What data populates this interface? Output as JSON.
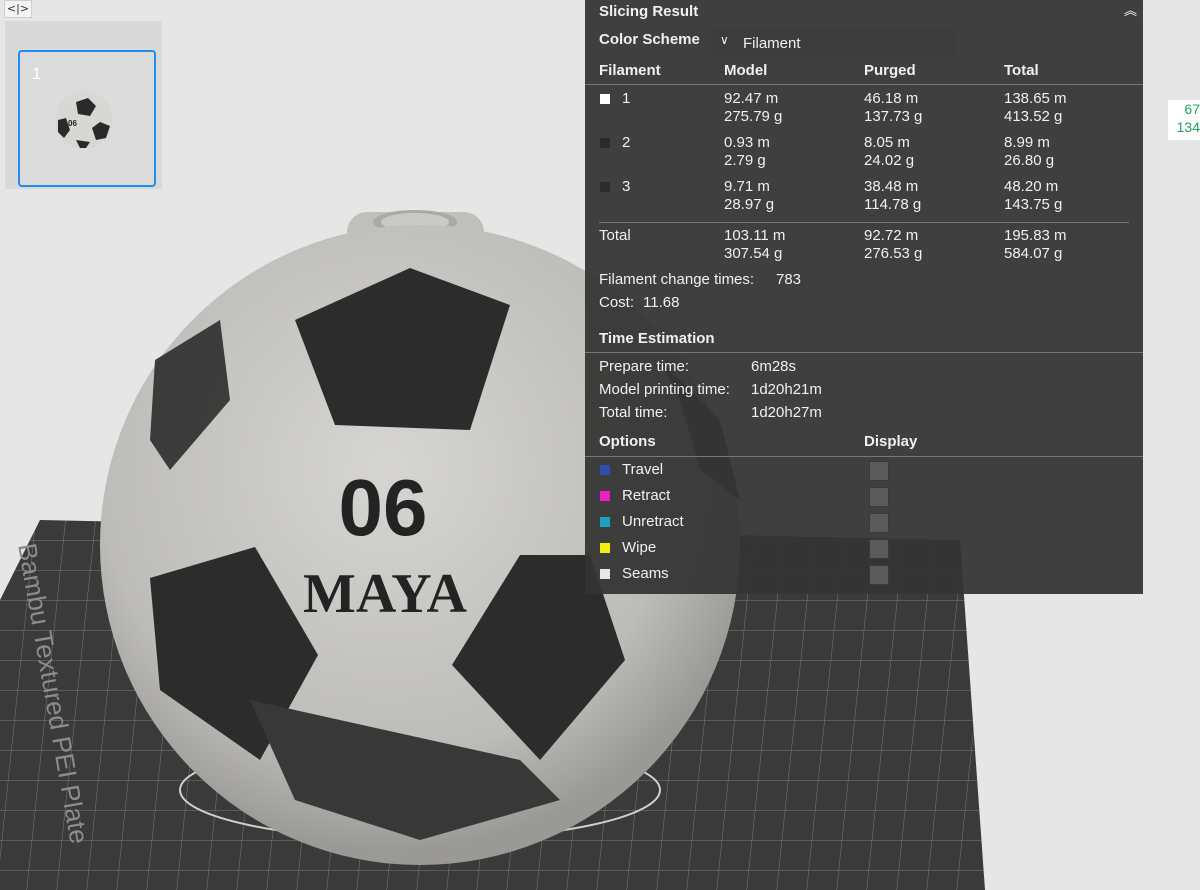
{
  "viewport": {
    "plate_text": "Bambu Textured PEI Plate",
    "model_number": "06",
    "model_name": "MAYA"
  },
  "thumbnail": {
    "toggle_icon": "<|>",
    "plate_number": "1"
  },
  "side_numbers": [
    "67",
    "134"
  ],
  "slicing_result": {
    "title": "Slicing Result",
    "collapse_icon": "double-chevron-up-icon",
    "color_scheme_label": "Color Scheme",
    "color_scheme_value": "Filament",
    "headers": [
      "Filament",
      "Model",
      "Purged",
      "Total"
    ],
    "filaments": [
      {
        "id": "1",
        "color": "#ffffff",
        "model": [
          "92.47 m",
          "275.79 g"
        ],
        "purged": [
          "46.18 m",
          "137.73 g"
        ],
        "total": [
          "138.65 m",
          "413.52 g"
        ]
      },
      {
        "id": "2",
        "color": "#2b2b2b",
        "model": [
          "0.93 m",
          "2.79 g"
        ],
        "purged": [
          "8.05 m",
          "24.02 g"
        ],
        "total": [
          "8.99 m",
          "26.80 g"
        ]
      },
      {
        "id": "3",
        "color": "#2b2b2b",
        "model": [
          "9.71 m",
          "28.97 g"
        ],
        "purged": [
          "38.48 m",
          "114.78 g"
        ],
        "total": [
          "48.20 m",
          "143.75 g"
        ]
      }
    ],
    "totals": {
      "label": "Total",
      "model": [
        "103.11 m",
        "307.54 g"
      ],
      "purged": [
        "92.72 m",
        "276.53 g"
      ],
      "total": [
        "195.83 m",
        "584.07 g"
      ]
    },
    "filament_change": {
      "label": "Filament change times:",
      "value": "783"
    },
    "cost": {
      "label": "Cost:",
      "value": "11.68"
    },
    "time_estimation": {
      "title": "Time Estimation",
      "rows": [
        {
          "label": "Prepare time:",
          "value": "6m28s"
        },
        {
          "label": "Model printing time:",
          "value": "1d20h21m"
        },
        {
          "label": "Total time:",
          "value": "1d20h27m"
        }
      ]
    },
    "options": {
      "title": "Options",
      "display_title": "Display",
      "items": [
        {
          "label": "Travel",
          "color": "#2f4fb0"
        },
        {
          "label": "Retract",
          "color": "#e81ec8"
        },
        {
          "label": "Unretract",
          "color": "#1aa3c0"
        },
        {
          "label": "Wipe",
          "color": "#f2ee10"
        },
        {
          "label": "Seams",
          "color": "#e8e8e8"
        }
      ]
    }
  }
}
